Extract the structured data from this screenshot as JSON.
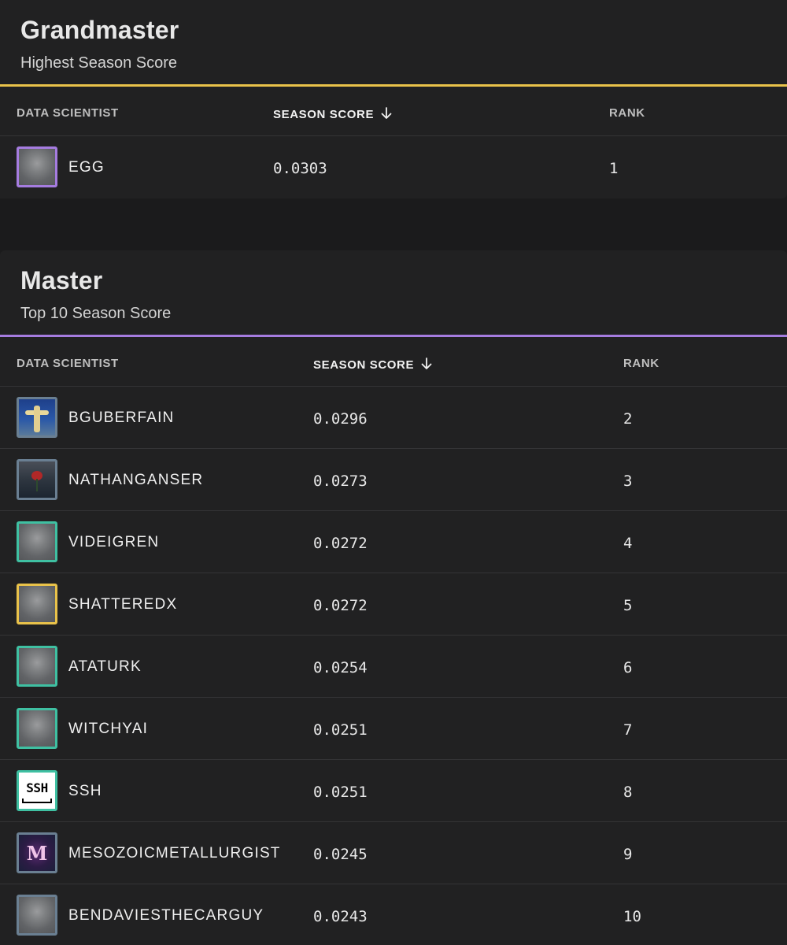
{
  "grandmaster": {
    "title": "Grandmaster",
    "subtitle": "Highest Season Score",
    "accent": "#e9c24a",
    "columns": {
      "name": "DATA SCIENTIST",
      "score": "SEASON SCORE",
      "rank": "RANK"
    },
    "sort_icon": "arrow-down-icon",
    "rows": [
      {
        "name": "EGG",
        "score": "0.0303",
        "rank": "1",
        "avatar": "default-silhouette",
        "frame_color": "#a57ce0"
      }
    ]
  },
  "master": {
    "title": "Master",
    "subtitle": "Top 10 Season Score",
    "accent": "#a57ce0",
    "columns": {
      "name": "DATA SCIENTIST",
      "score": "SEASON SCORE",
      "rank": "RANK"
    },
    "sort_icon": "arrow-down-icon",
    "rows": [
      {
        "name": "BGUBERFAIN",
        "score": "0.0296",
        "rank": "2",
        "avatar": "statue-photo",
        "frame_color": "#6a7f92"
      },
      {
        "name": "NATHANGANSER",
        "score": "0.0273",
        "rank": "3",
        "avatar": "rose-photo",
        "frame_color": "#6a7f92"
      },
      {
        "name": "VIDEIGREN",
        "score": "0.0272",
        "rank": "4",
        "avatar": "default-silhouette",
        "frame_color": "#3fc0a2"
      },
      {
        "name": "SHATTEREDX",
        "score": "0.0272",
        "rank": "5",
        "avatar": "default-silhouette",
        "frame_color": "#e9c24a"
      },
      {
        "name": "ATATURK",
        "score": "0.0254",
        "rank": "6",
        "avatar": "default-silhouette",
        "frame_color": "#3fc0a2"
      },
      {
        "name": "WITCHYAI",
        "score": "0.0251",
        "rank": "7",
        "avatar": "default-silhouette",
        "frame_color": "#3fc0a2"
      },
      {
        "name": "SSH",
        "score": "0.0251",
        "rank": "8",
        "avatar": "ssh-logo",
        "avatar_text": "SSH",
        "frame_color": "#3fc0a2"
      },
      {
        "name": "MESOZOICMETALLURGIST",
        "score": "0.0245",
        "rank": "9",
        "avatar": "m-emblem",
        "avatar_text": "M",
        "frame_color": "#6a7f92"
      },
      {
        "name": "BENDAVIESTHECARGUY",
        "score": "0.0243",
        "rank": "10",
        "avatar": "default-silhouette",
        "frame_color": "#6a7f92"
      }
    ]
  }
}
